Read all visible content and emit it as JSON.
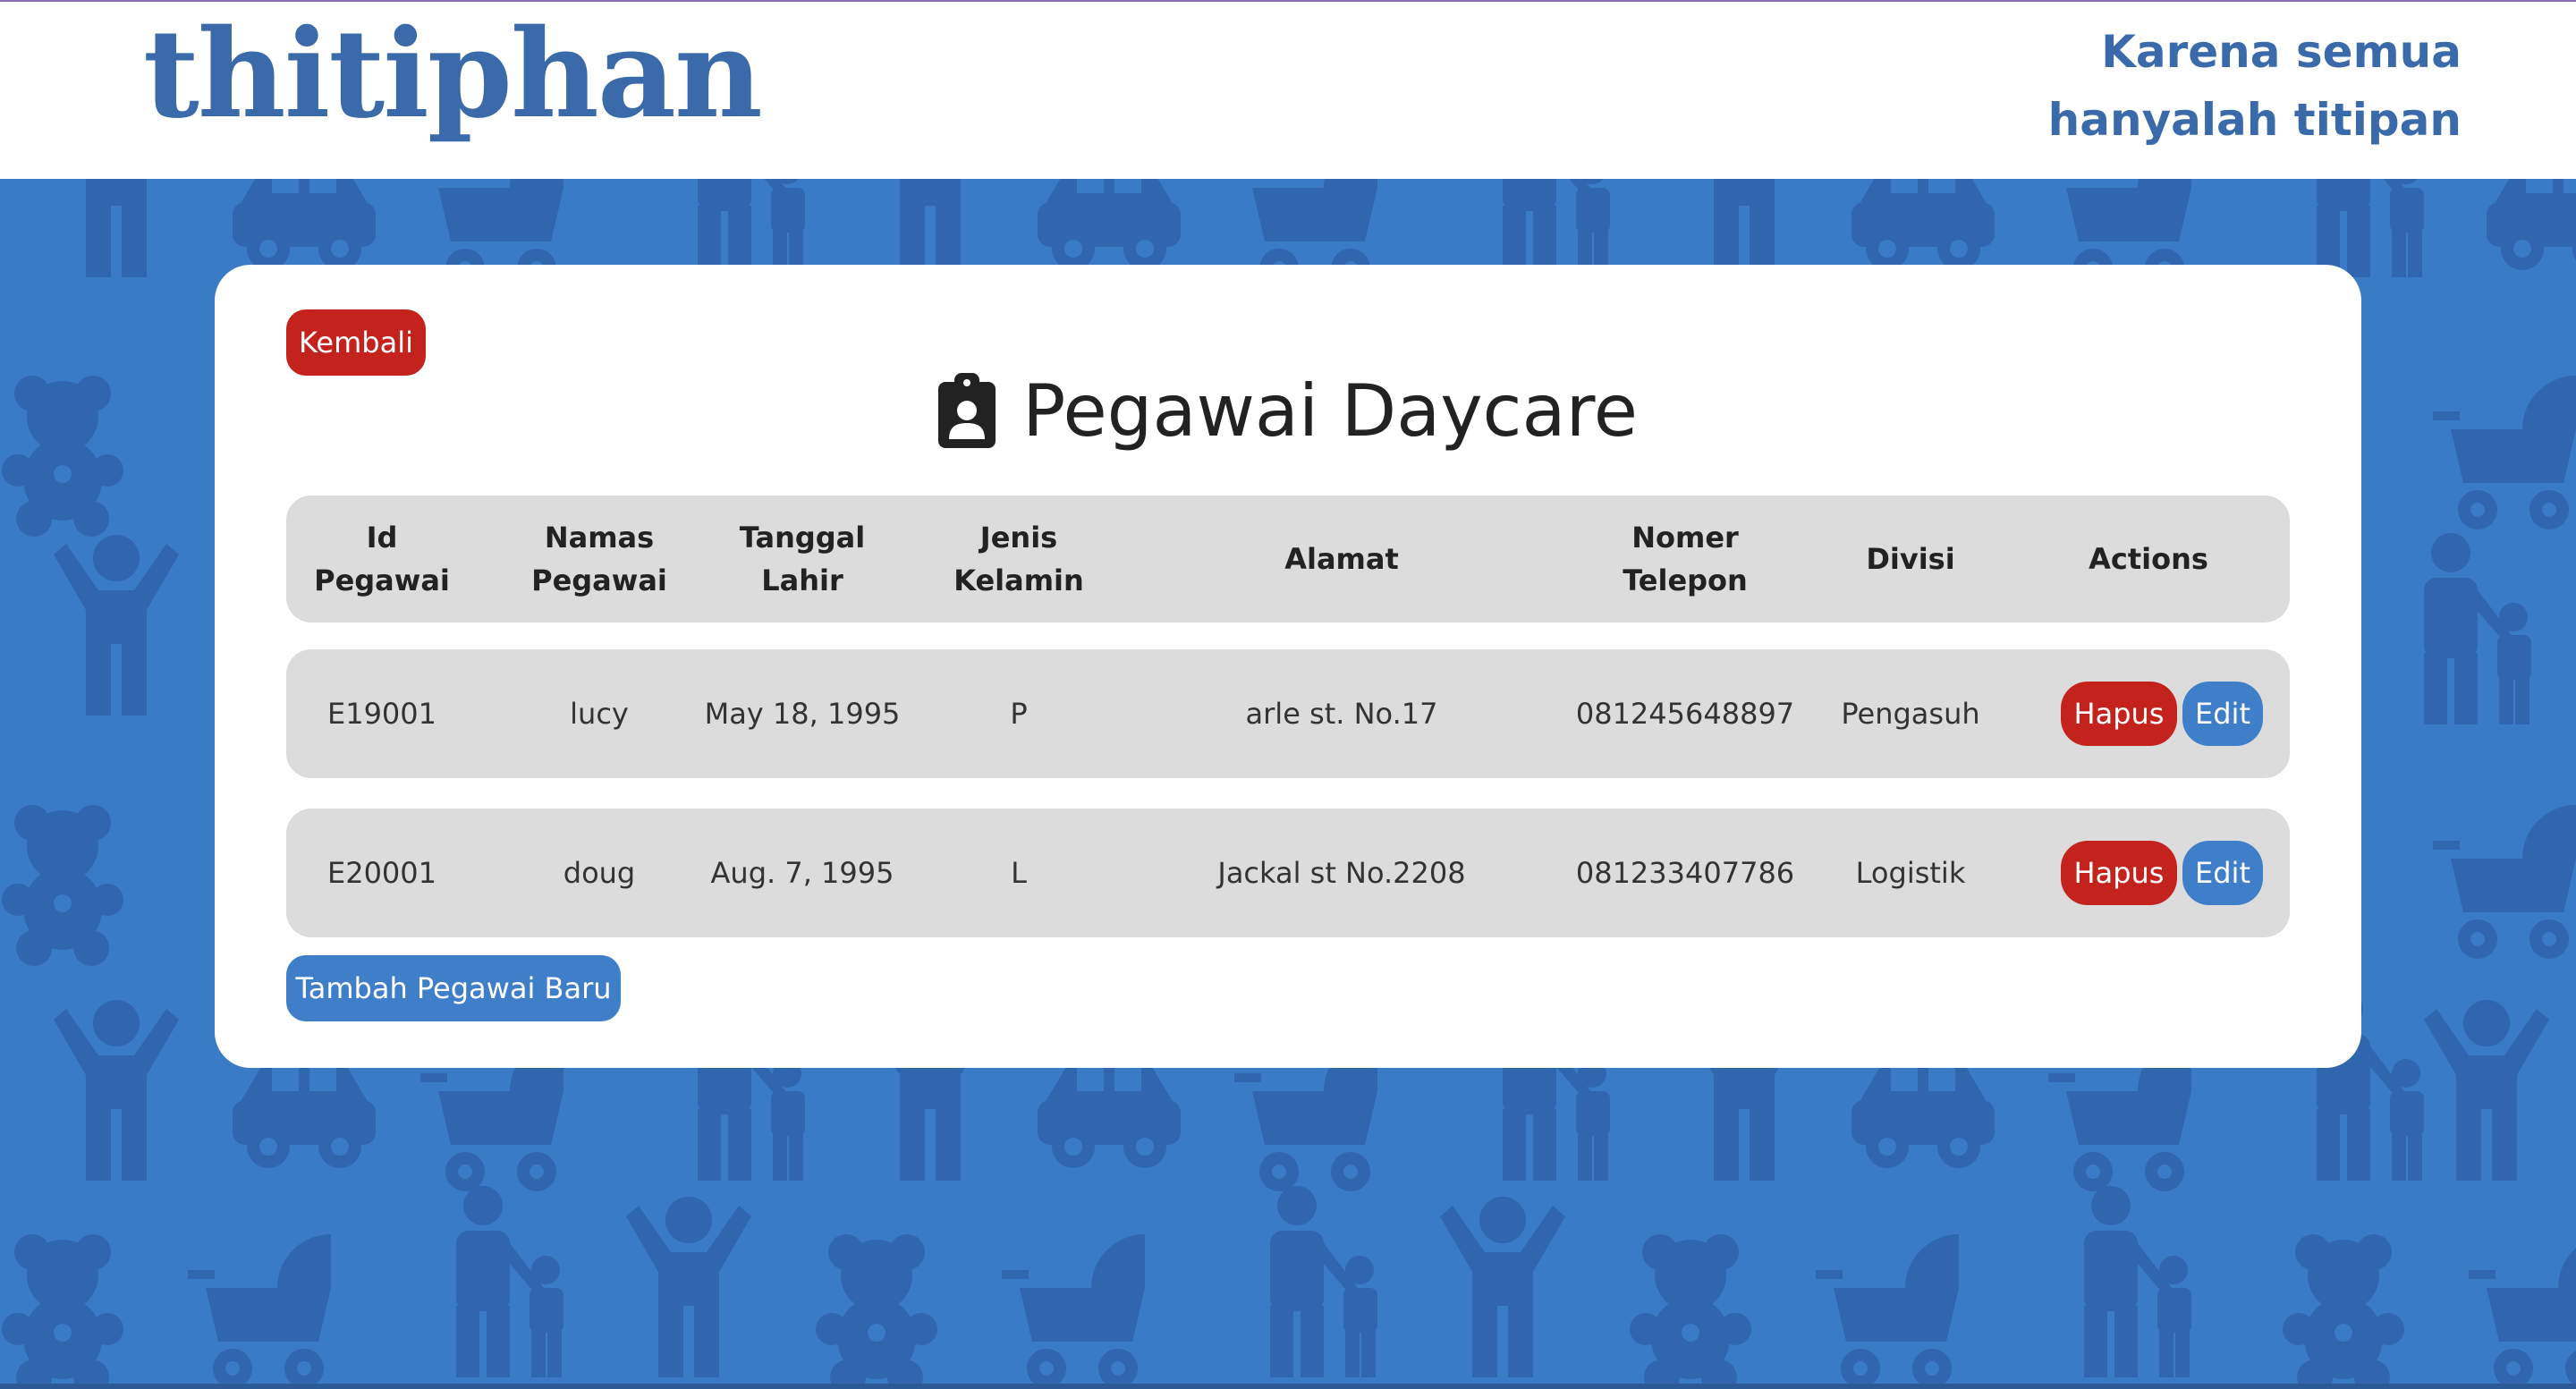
{
  "brand": {
    "logo_text": "thitiphan",
    "tagline_line1": "Karena semua",
    "tagline_line2": "hanyalah titipan"
  },
  "page": {
    "back_label": "Kembali",
    "title": "Pegawai Daycare",
    "title_icon": "clipboard-user-icon",
    "add_label": "Tambah Pegawai Baru"
  },
  "table": {
    "headers": {
      "id": "Id\nPegawai",
      "nama": "Namas\nPegawai",
      "tanggal": "Tanggal\nLahir",
      "jenis": "Jenis\nKelamin",
      "alamat": "Alamat",
      "telepon": "Nomer\nTelepon",
      "divisi": "Divisi",
      "actions": "Actions"
    },
    "rows": [
      {
        "id": "E19001",
        "nama": "lucy",
        "tanggal": "May 18, 1995",
        "jenis": "P",
        "alamat": "arle st. No.17",
        "telepon": "081245648897",
        "divisi": "Pengasuh",
        "hapus_label": "Hapus",
        "edit_label": "Edit"
      },
      {
        "id": "E20001",
        "nama": "doug",
        "tanggal": "Aug. 7, 1995",
        "jenis": "L",
        "alamat": "Jackal st No.2208",
        "telepon": "081233407786",
        "divisi": "Logistik",
        "hapus_label": "Hapus",
        "edit_label": "Edit"
      }
    ]
  },
  "colors": {
    "background": "#3a7bc6",
    "pattern": "#2f66ad",
    "brand": "#3a6aa9",
    "danger": "#c4221c",
    "primary": "#3f7fca",
    "row": "#dcdcdc"
  }
}
